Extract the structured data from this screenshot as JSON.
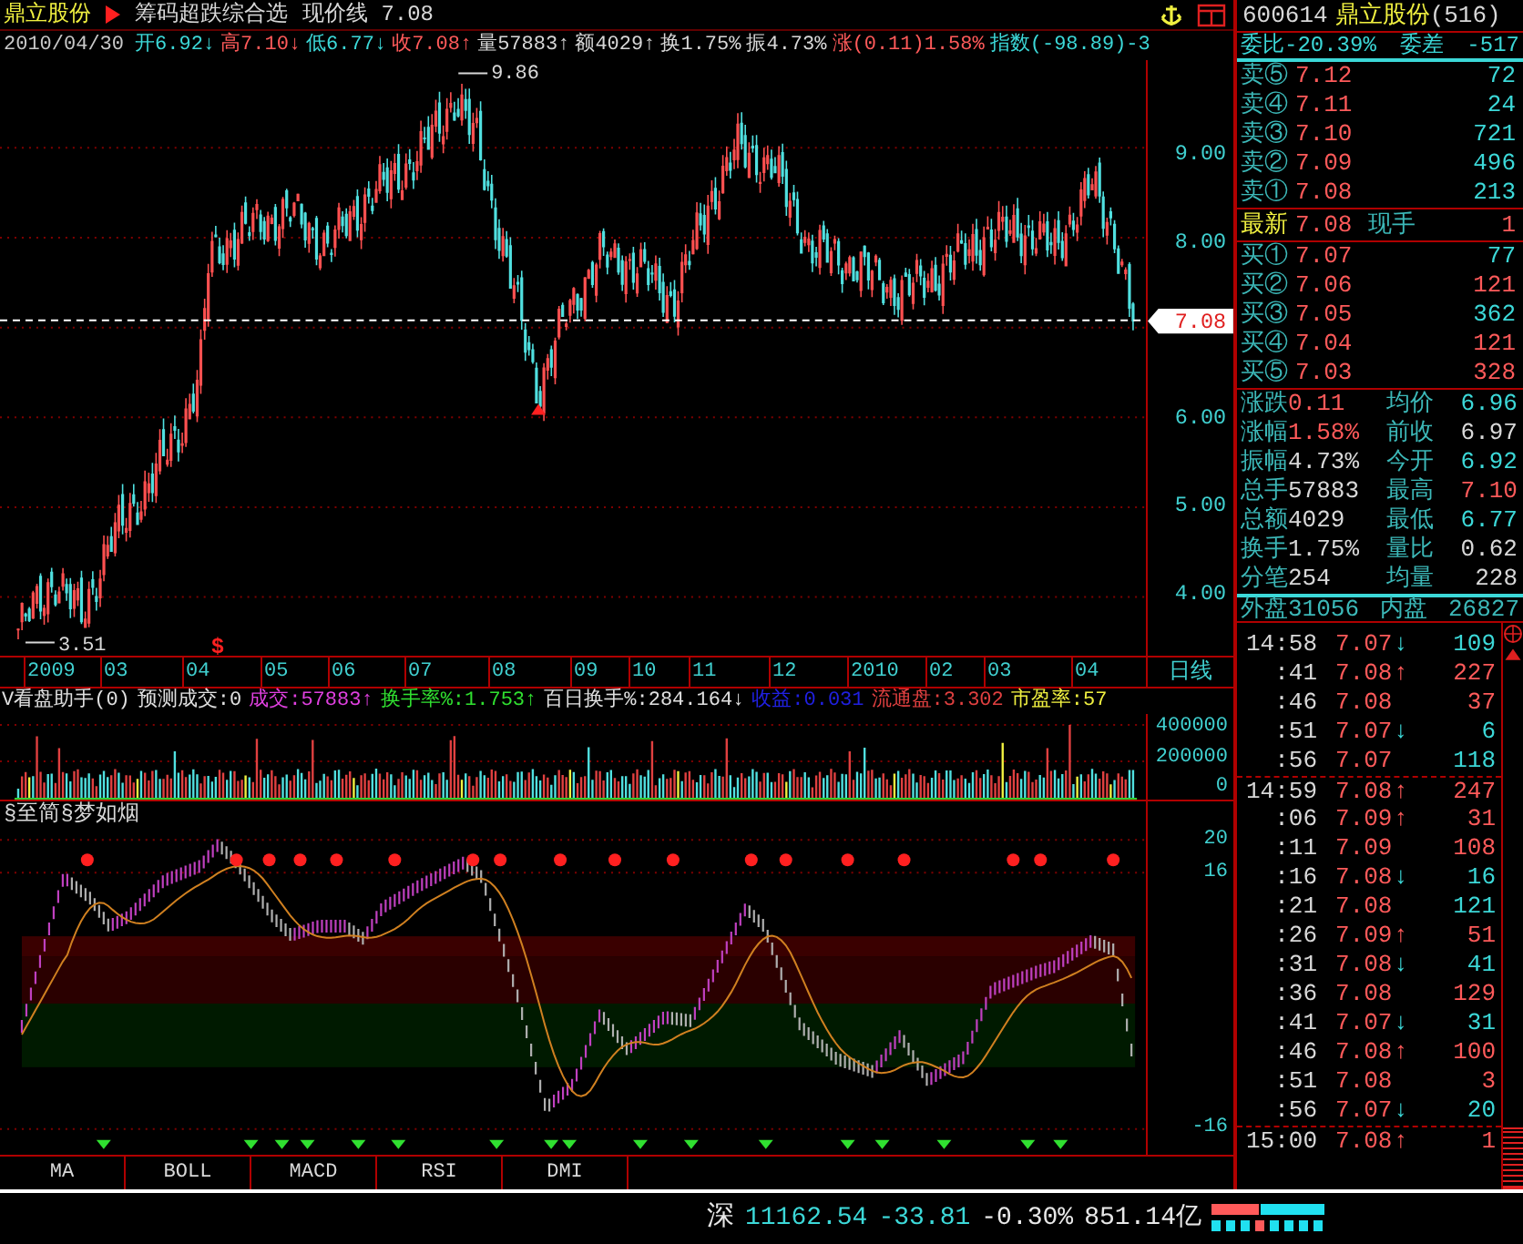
{
  "title_bar": {
    "stock_name": "鼎立股份",
    "formula": "筹码超跌综合选",
    "price_line": "现价线 7.08"
  },
  "quote_line": {
    "date": "2010/04/30",
    "items": [
      {
        "label": "开",
        "value": "6.92",
        "color": "#3cd8d8",
        "arrow": "↓"
      },
      {
        "label": "高",
        "value": "7.10",
        "color": "#ff5a5a",
        "arrow": "↓"
      },
      {
        "label": "低",
        "value": "6.77",
        "color": "#3cd8d8",
        "arrow": "↓"
      },
      {
        "label": "收",
        "value": "7.08",
        "color": "#ff5a5a",
        "arrow": "↑"
      },
      {
        "label": "量",
        "value": "57883",
        "color": "#d8d8d8",
        "arrow": "↑"
      },
      {
        "label": "额",
        "value": "4029",
        "color": "#d8d8d8",
        "arrow": "↑"
      },
      {
        "label": "换",
        "value": "1.75%",
        "color": "#d8d8d8"
      },
      {
        "label": "振",
        "value": "4.73%",
        "color": "#d8d8d8"
      },
      {
        "label": "涨",
        "value": "(0.11)1.58%",
        "color": "#ff5a5a"
      },
      {
        "label": "指数",
        "value": "(-98.89)-3",
        "color": "#3cd8d8"
      }
    ]
  },
  "main_chart": {
    "price_axis": [
      "9.00",
      "8.00",
      "6.00",
      "5.00",
      "4.00"
    ],
    "current_price_tag": "7.08",
    "high_marker": "9.86",
    "low_marker": "3.51",
    "signal_mark": "$"
  },
  "month_axis": {
    "labels": [
      "2009",
      "03",
      "04",
      "05",
      "06",
      "07",
      "08",
      "09",
      "10",
      "11",
      "12",
      "2010",
      "02",
      "03",
      "04"
    ],
    "period": "日线"
  },
  "volume_panel": {
    "header": [
      {
        "text": "V看盘助手(0)",
        "color": "#e0e0e0"
      },
      {
        "text": "预测成交:0",
        "color": "#e0e0e0"
      },
      {
        "text": "成交:57883↑",
        "color": "#e040e0"
      },
      {
        "text": "换手率%:1.753↑",
        "color": "#30e030"
      },
      {
        "text": "百日换手%:284.164↓",
        "color": "#e0e0e0"
      },
      {
        "text": "收益:0.031",
        "color": "#2020e0"
      },
      {
        "text": "流通盘:3.302",
        "color": "#e04040"
      },
      {
        "text": "市盈率:57",
        "color": "#f0f040"
      }
    ],
    "axis": [
      "400000",
      "200000",
      "0"
    ]
  },
  "oscillator": {
    "title": "§至简§梦如烟",
    "axis": [
      "20",
      "16",
      "-16"
    ]
  },
  "tabs": [
    {
      "label": "MA",
      "selected": false
    },
    {
      "label": "BOLL",
      "selected": false
    },
    {
      "label": "MACD",
      "selected": false
    },
    {
      "label": "RSI",
      "selected": false
    },
    {
      "label": "DMI",
      "selected": false
    }
  ],
  "status_bar": {
    "market": "深",
    "index": "11162.54",
    "change": "-33.81",
    "change_pct": "-0.30%",
    "turnover": "851.14亿"
  },
  "quote_panel": {
    "code": "600614",
    "name": "鼎立股份",
    "count": "(516)",
    "ratio_label": "委比",
    "ratio": "-20.39%",
    "diff_label": "委差",
    "diff": "-517",
    "asks": [
      {
        "label": "卖⑤",
        "price": "7.12",
        "volume": "72",
        "color": "#3cd8d8"
      },
      {
        "label": "卖④",
        "price": "7.11",
        "volume": "24",
        "color": "#3cd8d8"
      },
      {
        "label": "卖③",
        "price": "7.10",
        "volume": "721",
        "color": "#3cd8d8"
      },
      {
        "label": "卖②",
        "price": "7.09",
        "volume": "496",
        "color": "#3cd8d8"
      },
      {
        "label": "卖①",
        "price": "7.08",
        "volume": "213",
        "color": "#3cd8d8"
      }
    ],
    "last": {
      "label": "最新",
      "price": "7.08",
      "hand_label": "现手",
      "hand": "1"
    },
    "bids": [
      {
        "label": "买①",
        "price": "7.07",
        "volume": "77",
        "color": "#3cd8d8"
      },
      {
        "label": "买②",
        "price": "7.06",
        "volume": "121",
        "color": "#ff5a5a"
      },
      {
        "label": "买③",
        "price": "7.05",
        "volume": "362",
        "color": "#3cd8d8"
      },
      {
        "label": "买④",
        "price": "7.04",
        "volume": "121",
        "color": "#ff5a5a"
      },
      {
        "label": "买⑤",
        "price": "7.03",
        "volume": "328",
        "color": "#ff5a5a"
      }
    ],
    "stats": [
      {
        "label": "涨跌",
        "value": "0.11",
        "color": "#ff5a5a"
      },
      {
        "label": "均价",
        "value": "6.96",
        "color": "#3cd8d8"
      },
      {
        "label": "涨幅",
        "value": "1.58%",
        "color": "#ff5a5a"
      },
      {
        "label": "前收",
        "value": "6.97",
        "color": "#d8d8d8"
      },
      {
        "label": "振幅",
        "value": "4.73%",
        "color": "#d8d8d8"
      },
      {
        "label": "今开",
        "value": "6.92",
        "color": "#3cd8d8"
      },
      {
        "label": "总手",
        "value": "57883",
        "color": "#d8d8d8"
      },
      {
        "label": "最高",
        "value": "7.10",
        "color": "#ff5a5a"
      },
      {
        "label": "总额",
        "value": "4029",
        "color": "#d8d8d8"
      },
      {
        "label": "最低",
        "value": "6.77",
        "color": "#3cd8d8"
      },
      {
        "label": "换手",
        "value": "1.75%",
        "color": "#d8d8d8"
      },
      {
        "label": "量比",
        "value": "0.62",
        "color": "#d8d8d8"
      },
      {
        "label": "分笔",
        "value": "254",
        "color": "#d8d8d8"
      },
      {
        "label": "均量",
        "value": "228",
        "color": "#d8d8d8"
      }
    ],
    "outer_label": "外盘",
    "outer": "31056",
    "inner_label": "内盘",
    "inner": "26827"
  },
  "ticks": [
    {
      "time": "14:58",
      "price": "7.07",
      "arrow": "↓",
      "volume": "109",
      "color": "#3cd8d8",
      "group_start": false
    },
    {
      "time": ":41",
      "price": "7.08",
      "arrow": "↑",
      "volume": "227",
      "color": "#ff5a5a",
      "group_start": false
    },
    {
      "time": ":46",
      "price": "7.08",
      "volume": "37",
      "color": "#ff5a5a",
      "group_start": false
    },
    {
      "time": ":51",
      "price": "7.07",
      "arrow": "↓",
      "volume": "6",
      "color": "#3cd8d8",
      "group_start": false
    },
    {
      "time": ":56",
      "price": "7.07",
      "volume": "118",
      "color": "#3cd8d8",
      "group_start": false
    },
    {
      "time": "14:59",
      "price": "7.08",
      "arrow": "↑",
      "volume": "247",
      "color": "#ff5a5a",
      "group_start": true
    },
    {
      "time": ":06",
      "price": "7.09",
      "arrow": "↑",
      "volume": "31",
      "color": "#ff5a5a",
      "group_start": false
    },
    {
      "time": ":11",
      "price": "7.09",
      "volume": "108",
      "color": "#ff5a5a",
      "group_start": false
    },
    {
      "time": ":16",
      "price": "7.08",
      "arrow": "↓",
      "volume": "16",
      "color": "#3cd8d8",
      "group_start": false
    },
    {
      "time": ":21",
      "price": "7.08",
      "volume": "121",
      "color": "#3cd8d8",
      "group_start": false
    },
    {
      "time": ":26",
      "price": "7.09",
      "arrow": "↑",
      "volume": "51",
      "color": "#ff5a5a",
      "group_start": false
    },
    {
      "time": ":31",
      "price": "7.08",
      "arrow": "↓",
      "volume": "41",
      "color": "#3cd8d8",
      "group_start": false
    },
    {
      "time": ":36",
      "price": "7.08",
      "volume": "129",
      "color": "#ff5a5a",
      "group_start": false
    },
    {
      "time": ":41",
      "price": "7.07",
      "arrow": "↓",
      "volume": "31",
      "color": "#3cd8d8",
      "group_start": false
    },
    {
      "time": ":46",
      "price": "7.08",
      "arrow": "↑",
      "volume": "100",
      "color": "#ff5a5a",
      "group_start": false
    },
    {
      "time": ":51",
      "price": "7.08",
      "volume": "3",
      "color": "#ff5a5a",
      "group_start": false
    },
    {
      "time": ":56",
      "price": "7.07",
      "arrow": "↓",
      "volume": "20",
      "color": "#3cd8d8",
      "group_start": false
    },
    {
      "time": "15:00",
      "price": "7.08",
      "arrow": "↑",
      "volume": "1",
      "color": "#ff5a5a",
      "group_start": true
    }
  ]
}
